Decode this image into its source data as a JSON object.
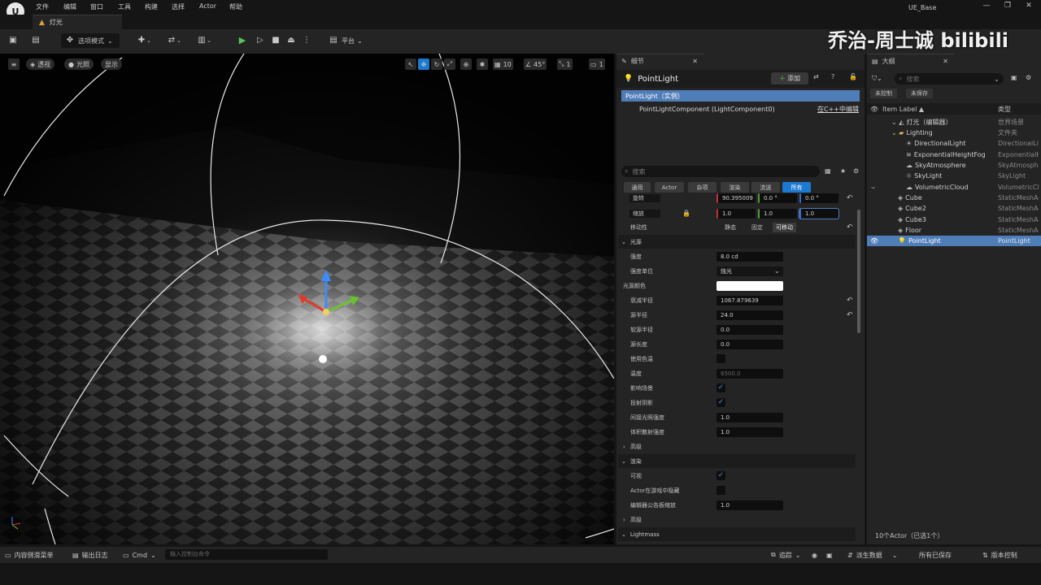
{
  "menu": [
    "文件",
    "编辑",
    "窗口",
    "工具",
    "构建",
    "选择",
    "Actor",
    "帮助"
  ],
  "app_title": "UE_Base",
  "window_controls": [
    "—",
    "❐",
    "✕"
  ],
  "level_tab": "灯光",
  "toolbar": {
    "mode_label": "选项模式",
    "platform_label": "平台"
  },
  "watermark": "乔治-周士诚 bilibili",
  "viewport": {
    "view_mode": "透视",
    "lit_mode": "光照",
    "show_label": "显示",
    "grid_snap": "10",
    "rotate_snap": "45°",
    "scale_snap": "1",
    "camera_speed": "1"
  },
  "details": {
    "tab_title": "细节",
    "actor_name": "PointLight",
    "add_label": "添加",
    "instance_row": "PointLight（实例）",
    "component_row": "PointLightComponent (LightComponent0)",
    "component_edit_link": "在C++中编辑",
    "search_placeholder": "搜索",
    "filter_tabs": [
      "通用",
      "Actor",
      "杂项",
      "渲染",
      "流送",
      "所有"
    ],
    "rotation_label": "旋转",
    "rotation_values": [
      "90.395009 °",
      "0.0 °",
      "0.0 °"
    ],
    "scale_label": "缩放",
    "scale_values": [
      "1.0",
      "1.0",
      "1.0"
    ],
    "mobility_label": "移动性",
    "mobility_options": [
      "静态",
      "固定",
      "可移动"
    ],
    "section_light": "光源",
    "intensity_label": "强度",
    "intensity_value": "8.0 cd",
    "intensity_unit_label": "强度单位",
    "intensity_unit_value": "烛光",
    "light_color_label": "光源颜色",
    "attenuation_label": "衰减半径",
    "attenuation_value": "1067.879639",
    "source_radius_label": "源半径",
    "source_radius_value": "24.0",
    "soft_radius_label": "软源半径",
    "soft_radius_value": "0.0",
    "source_length_label": "源长度",
    "source_length_value": "0.0",
    "use_temp_label": "使用色温",
    "temperature_label": "温度",
    "temperature_value": "6500.0",
    "affects_world_label": "影响场景",
    "cast_shadows_label": "投射阴影",
    "indirect_label": "间接光照强度",
    "indirect_value": "1.0",
    "volumetric_label": "体积散射强度",
    "volumetric_value": "1.0",
    "section_advanced": "高级",
    "section_render": "渲染",
    "visible_label": "可视",
    "hidden_in_game_label": "Actor在游戏中隐藏",
    "billboard_label": "编辑器公告板缩放",
    "billboard_value": "1.0",
    "section_advanced2": "高级",
    "section_lightmass": "Lightmass"
  },
  "outliner": {
    "tab_title": "大纲",
    "search_placeholder": "搜索",
    "chip_uncontrolled": "未控制",
    "chip_unsaved": "未保存",
    "col_label": "Item Label ▲",
    "col_type": "类型",
    "rows": [
      {
        "name": "灯光（编辑器）",
        "type": "世界场景",
        "icon": "world-icon"
      },
      {
        "name": "Lighting",
        "type": "文件夹",
        "icon": "folder-icon"
      },
      {
        "name": "DirectionalLight",
        "type": "DirectionalLi",
        "icon": "directional-light-icon"
      },
      {
        "name": "ExponentialHeightFog",
        "type": "ExponentialH",
        "icon": "fog-icon"
      },
      {
        "name": "SkyAtmosphere",
        "type": "SkyAtmosphe",
        "icon": "sky-atmosphere-icon"
      },
      {
        "name": "SkyLight",
        "type": "SkyLight",
        "icon": "sky-light-icon"
      },
      {
        "name": "VolumetricCloud",
        "type": "VolumetricClo",
        "icon": "cloud-icon"
      },
      {
        "name": "Cube",
        "type": "StaticMeshAc",
        "icon": "mesh-icon"
      },
      {
        "name": "Cube2",
        "type": "StaticMeshAc",
        "icon": "mesh-icon"
      },
      {
        "name": "Cube3",
        "type": "StaticMeshAc",
        "icon": "mesh-icon"
      },
      {
        "name": "Floor",
        "type": "StaticMeshAc",
        "icon": "mesh-icon"
      },
      {
        "name": "PointLight",
        "type": "PointLight",
        "icon": "point-light-icon"
      }
    ],
    "footer": "10个Actor（已选1个）"
  },
  "statusbar": {
    "content_drawer": "内容侧滑菜单",
    "output_log": "输出日志",
    "cmd": "Cmd",
    "cmd_placeholder": "输入控制台命令",
    "trace": "追踪",
    "derived_data": "派生数据",
    "all_saved": "所有已保存",
    "source_control": "版本控制"
  },
  "colors": {
    "accent": "#1c79d0",
    "selection": "#4f7db8",
    "panel": "#242424",
    "background": "#151515"
  }
}
